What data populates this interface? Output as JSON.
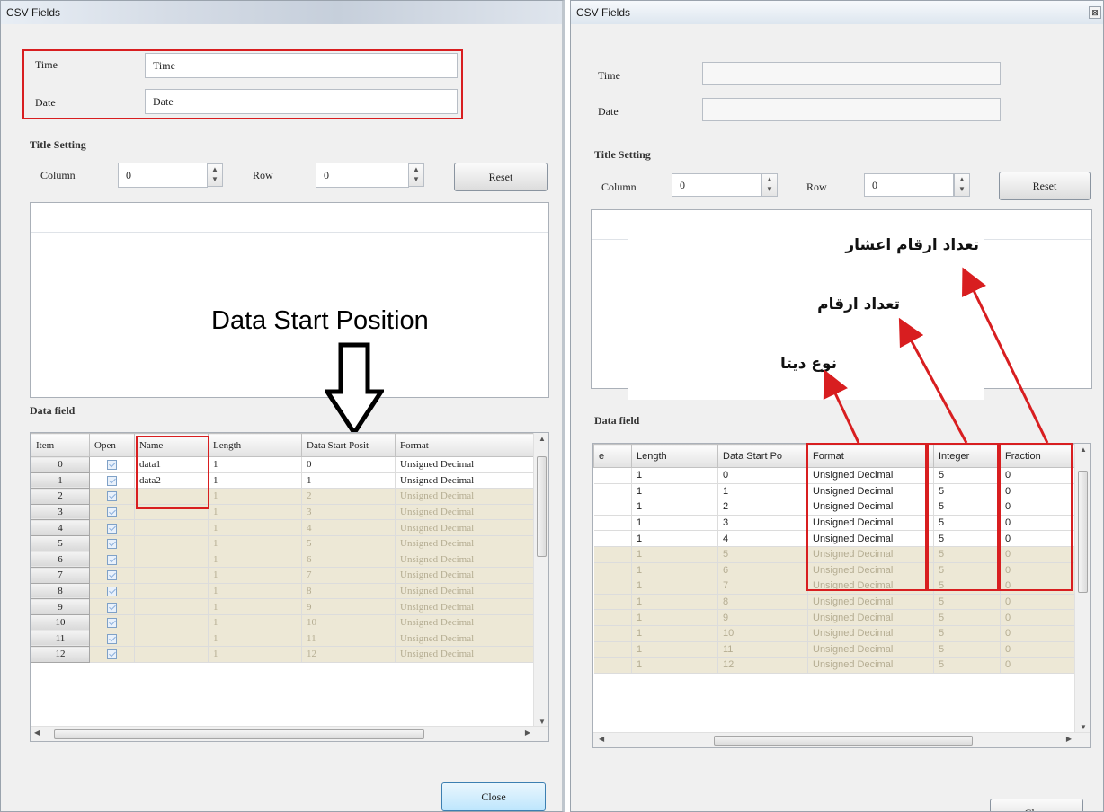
{
  "left": {
    "title": "CSV Fields",
    "time_label": "Time",
    "time_value": "Time",
    "date_label": "Date",
    "date_value": "Date",
    "title_setting": "Title Setting",
    "column_label": "Column",
    "column_value": "0",
    "row_label": "Row",
    "row_value": "0",
    "reset": "Reset",
    "data_field": "Data field",
    "headers": [
      "Item",
      "Open",
      "Name",
      "Length",
      "Data Start Posit",
      "Format"
    ],
    "rows": [
      {
        "item": "0",
        "name": "data1",
        "length": "1",
        "start": "0",
        "format": "Unsigned Decimal",
        "active": true
      },
      {
        "item": "1",
        "name": "data2",
        "length": "1",
        "start": "1",
        "format": "Unsigned Decimal",
        "active": true
      },
      {
        "item": "2",
        "name": "",
        "length": "1",
        "start": "2",
        "format": "Unsigned Decimal",
        "active": false
      },
      {
        "item": "3",
        "name": "",
        "length": "1",
        "start": "3",
        "format": "Unsigned Decimal",
        "active": false
      },
      {
        "item": "4",
        "name": "",
        "length": "1",
        "start": "4",
        "format": "Unsigned Decimal",
        "active": false
      },
      {
        "item": "5",
        "name": "",
        "length": "1",
        "start": "5",
        "format": "Unsigned Decimal",
        "active": false
      },
      {
        "item": "6",
        "name": "",
        "length": "1",
        "start": "6",
        "format": "Unsigned Decimal",
        "active": false
      },
      {
        "item": "7",
        "name": "",
        "length": "1",
        "start": "7",
        "format": "Unsigned Decimal",
        "active": false
      },
      {
        "item": "8",
        "name": "",
        "length": "1",
        "start": "8",
        "format": "Unsigned Decimal",
        "active": false
      },
      {
        "item": "9",
        "name": "",
        "length": "1",
        "start": "9",
        "format": "Unsigned Decimal",
        "active": false
      },
      {
        "item": "10",
        "name": "",
        "length": "1",
        "start": "10",
        "format": "Unsigned Decimal",
        "active": false
      },
      {
        "item": "11",
        "name": "",
        "length": "1",
        "start": "11",
        "format": "Unsigned Decimal",
        "active": false
      },
      {
        "item": "12",
        "name": "",
        "length": "1",
        "start": "12",
        "format": "Unsigned Decimal",
        "active": false
      }
    ],
    "close": "Close",
    "annotation": "Data Start Position"
  },
  "right": {
    "title": "CSV Fields",
    "time_label": "Time",
    "date_label": "Date",
    "title_setting": "Title Setting",
    "column_label": "Column",
    "column_value": "0",
    "row_label": "Row",
    "row_value": "0",
    "reset": "Reset",
    "data_field": "Data field",
    "headers": [
      "e",
      "Length",
      "Data Start Po",
      "Format",
      "Integer",
      "Fraction"
    ],
    "rows": [
      {
        "length": "1",
        "start": "0",
        "format": "Unsigned Decimal",
        "integer": "5",
        "fraction": "0",
        "active": true
      },
      {
        "length": "1",
        "start": "1",
        "format": "Unsigned Decimal",
        "integer": "5",
        "fraction": "0",
        "active": true
      },
      {
        "length": "1",
        "start": "2",
        "format": "Unsigned Decimal",
        "integer": "5",
        "fraction": "0",
        "active": true
      },
      {
        "length": "1",
        "start": "3",
        "format": "Unsigned Decimal",
        "integer": "5",
        "fraction": "0",
        "active": true
      },
      {
        "length": "1",
        "start": "4",
        "format": "Unsigned Decimal",
        "integer": "5",
        "fraction": "0",
        "active": true
      },
      {
        "length": "1",
        "start": "5",
        "format": "Unsigned Decimal",
        "integer": "5",
        "fraction": "0",
        "active": false
      },
      {
        "length": "1",
        "start": "6",
        "format": "Unsigned Decimal",
        "integer": "5",
        "fraction": "0",
        "active": false
      },
      {
        "length": "1",
        "start": "7",
        "format": "Unsigned Decimal",
        "integer": "5",
        "fraction": "0",
        "active": false
      },
      {
        "length": "1",
        "start": "8",
        "format": "Unsigned Decimal",
        "integer": "5",
        "fraction": "0",
        "active": false
      },
      {
        "length": "1",
        "start": "9",
        "format": "Unsigned Decimal",
        "integer": "5",
        "fraction": "0",
        "active": false
      },
      {
        "length": "1",
        "start": "10",
        "format": "Unsigned Decimal",
        "integer": "5",
        "fraction": "0",
        "active": false
      },
      {
        "length": "1",
        "start": "11",
        "format": "Unsigned Decimal",
        "integer": "5",
        "fraction": "0",
        "active": false
      },
      {
        "length": "1",
        "start": "12",
        "format": "Unsigned Decimal",
        "integer": "5",
        "fraction": "0",
        "active": false
      }
    ],
    "close": "Close",
    "annot_fraction": "تعداد ارقام اعشار",
    "annot_integer": "تعداد ارقام",
    "annot_format": "نوع دیتا"
  },
  "colors": {
    "annotation_red": "#d81e20"
  }
}
